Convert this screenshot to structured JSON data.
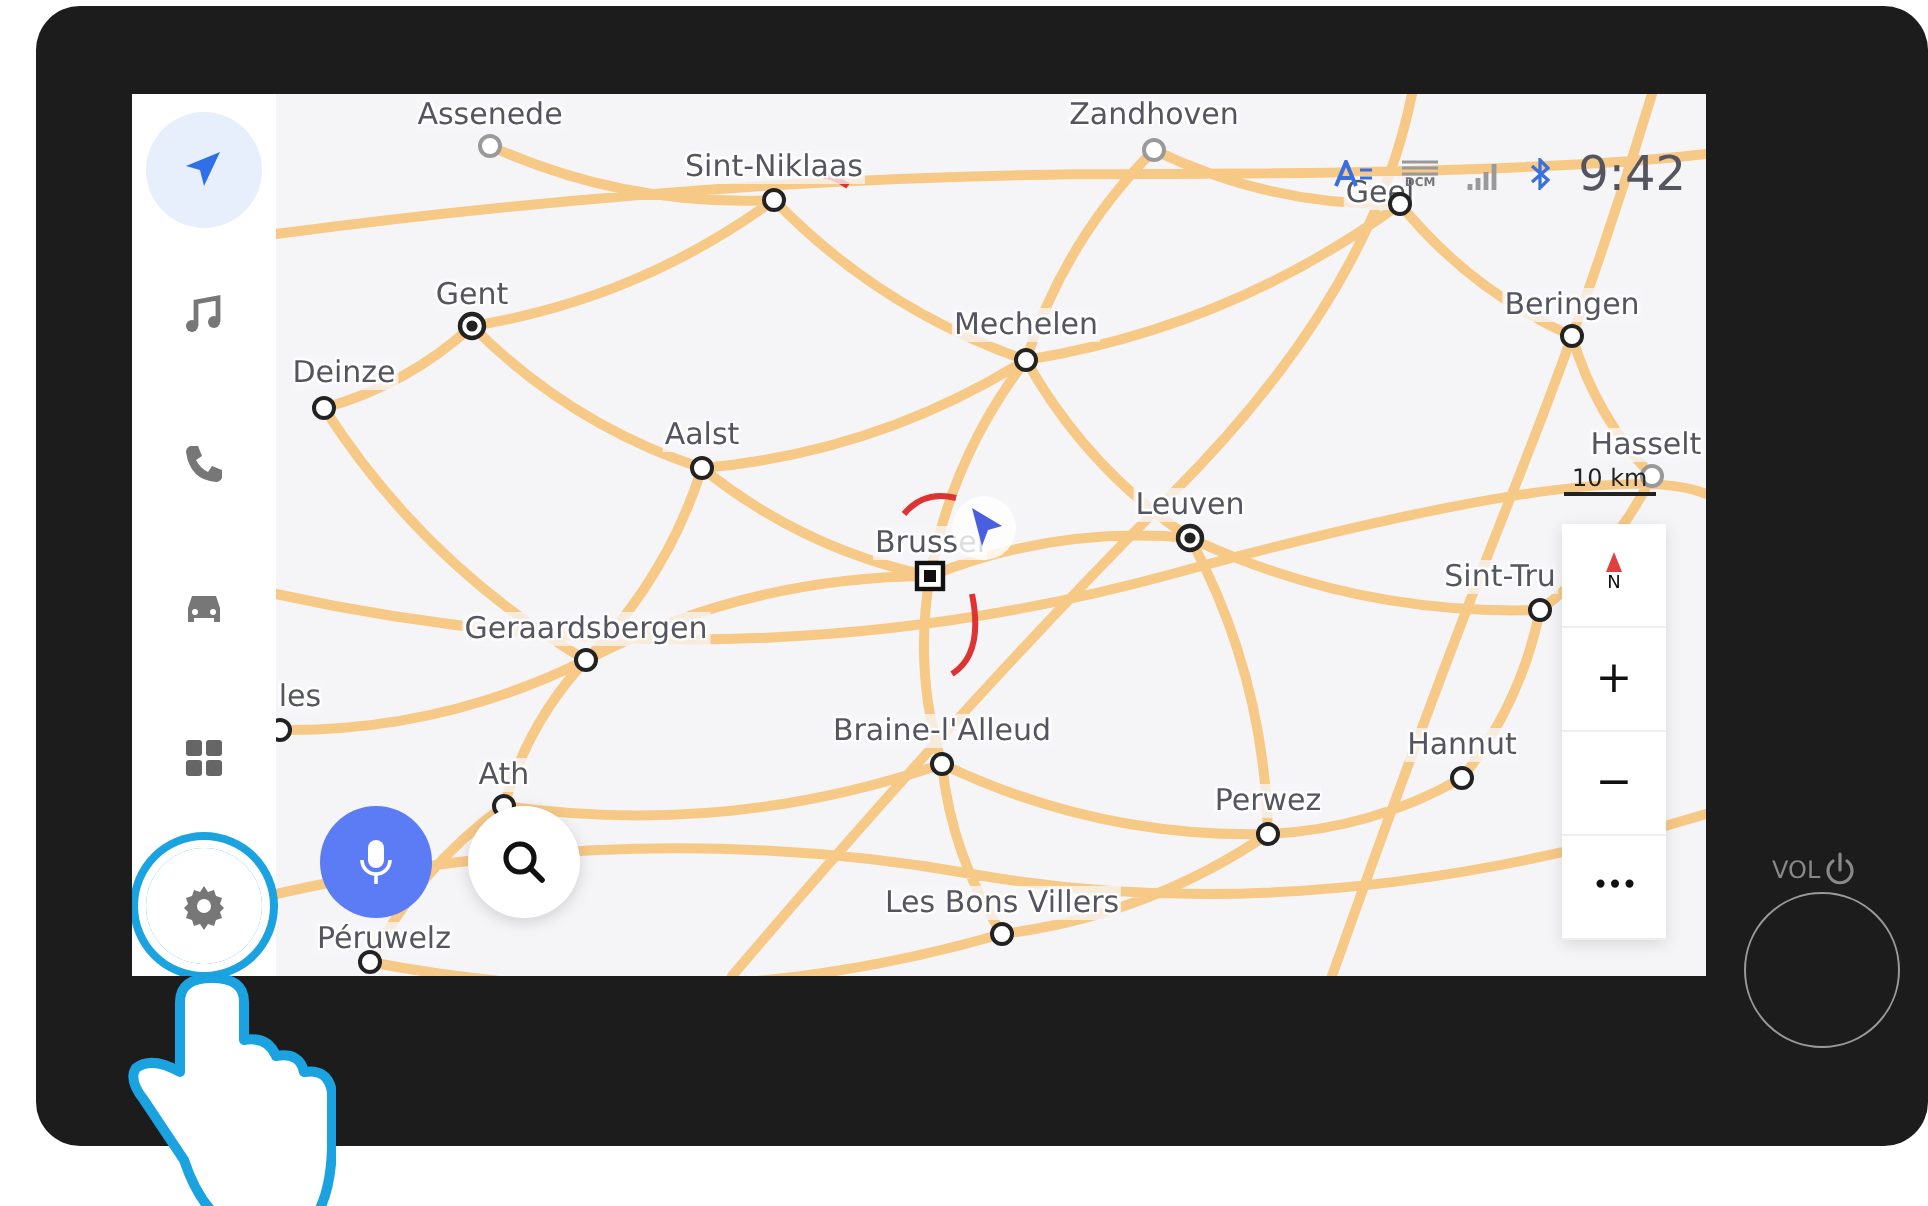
{
  "sidebar": {
    "items": [
      {
        "kind": "navigation",
        "selected": true,
        "highlighted": false
      },
      {
        "kind": "music",
        "selected": false,
        "highlighted": false
      },
      {
        "kind": "phone",
        "selected": false,
        "highlighted": false
      },
      {
        "kind": "car",
        "selected": false,
        "highlighted": false
      },
      {
        "kind": "apps",
        "selected": false,
        "highlighted": false
      },
      {
        "kind": "settings",
        "selected": false,
        "highlighted": true
      }
    ]
  },
  "status_bar": {
    "network_label": "DCM",
    "time": "9:42"
  },
  "map": {
    "cities": [
      {
        "name": "Assenede",
        "kind": "town"
      },
      {
        "name": "Sint-Niklaas",
        "kind": "city"
      },
      {
        "name": "Zandhoven",
        "kind": "town"
      },
      {
        "name": "Geel",
        "kind": "city"
      },
      {
        "name": "Gent",
        "kind": "major"
      },
      {
        "name": "Mechelen",
        "kind": "city"
      },
      {
        "name": "Beringen",
        "kind": "city"
      },
      {
        "name": "Deinze",
        "kind": "city"
      },
      {
        "name": "Aalst",
        "kind": "city"
      },
      {
        "name": "Hasselt",
        "kind": "town"
      },
      {
        "name": "Leuven",
        "kind": "major"
      },
      {
        "name": "Brussel",
        "kind": "capital"
      },
      {
        "name": "Sint-Tru",
        "kind": "city"
      },
      {
        "name": "Geraardsbergen",
        "kind": "city"
      },
      {
        "name": "les",
        "kind": "city"
      },
      {
        "name": "Braine-l'Alleud",
        "kind": "city"
      },
      {
        "name": "Hannut",
        "kind": "city"
      },
      {
        "name": "Ath",
        "kind": "city"
      },
      {
        "name": "Perwez",
        "kind": "city"
      },
      {
        "name": "Les Bons Villers",
        "kind": "city"
      },
      {
        "name": "Péruwelz",
        "kind": "city"
      }
    ],
    "scale": "10 km",
    "controls": {
      "compass": "N",
      "zoom_in": "+",
      "zoom_out": "−",
      "more": "•••"
    }
  },
  "knob": {
    "label": "VOL"
  }
}
